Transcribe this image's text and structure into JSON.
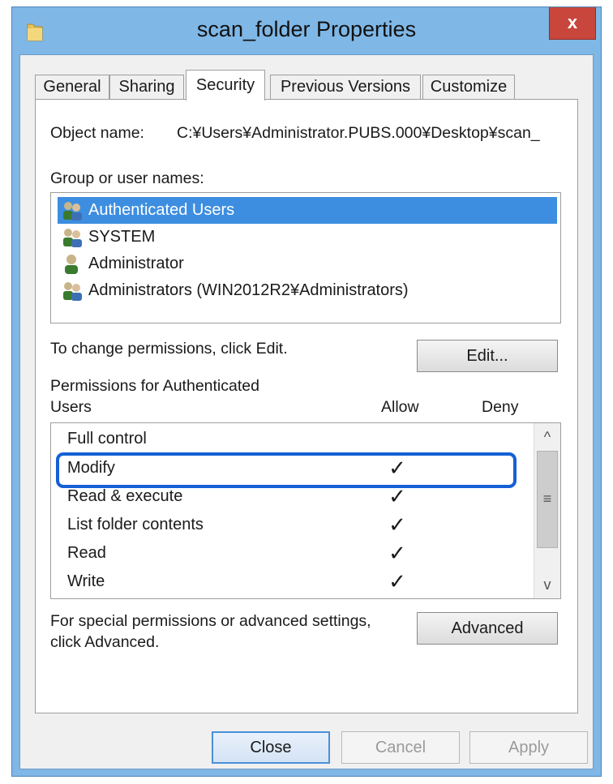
{
  "window": {
    "title": "scan_folder Properties",
    "close_label": "x"
  },
  "tabs": [
    {
      "label": "General",
      "active": false
    },
    {
      "label": "Sharing",
      "active": false
    },
    {
      "label": "Security",
      "active": true
    },
    {
      "label": "Previous Versions",
      "active": false
    },
    {
      "label": "Customize",
      "active": false
    }
  ],
  "security": {
    "object_name_label": "Object name:",
    "object_name_value": "C:¥Users¥Administrator.PUBS.000¥Desktop¥scan_",
    "group_label": "Group or user names:",
    "users": [
      {
        "label": "Authenticated Users",
        "icon": "group-users-icon",
        "selected": true
      },
      {
        "label": "SYSTEM",
        "icon": "group-users-icon",
        "selected": false
      },
      {
        "label": "Administrator",
        "icon": "single-user-icon",
        "selected": false
      },
      {
        "label": "Administrators (WIN2012R2¥Administrators)",
        "icon": "group-users-icon",
        "selected": false
      }
    ],
    "change_text": "To change permissions, click Edit.",
    "edit_button": "Edit...",
    "permissions_label_line1": "Permissions for Authenticated",
    "permissions_label_line2": "Users",
    "allow_header": "Allow",
    "deny_header": "Deny",
    "permissions": [
      {
        "name": "Full control",
        "allow": false,
        "deny": false
      },
      {
        "name": "Modify",
        "allow": true,
        "deny": false
      },
      {
        "name": "Read & execute",
        "allow": true,
        "deny": false
      },
      {
        "name": "List folder contents",
        "allow": true,
        "deny": false
      },
      {
        "name": "Read",
        "allow": true,
        "deny": false
      },
      {
        "name": "Write",
        "allow": true,
        "deny": false
      }
    ],
    "check_mark": "✓",
    "advanced_text_line1": "For special permissions or advanced settings,",
    "advanced_text_line2": "click Advanced.",
    "advanced_button": "Advanced"
  },
  "footer": {
    "close_button": "Close",
    "cancel_button": "Cancel",
    "apply_button": "Apply"
  },
  "scroll": {
    "up_arrow": "^",
    "down_arrow": "v",
    "thumb_grip": "≡"
  },
  "colors": {
    "title_bar": "#7fb7e6",
    "close_button": "#c9463d",
    "selection": "#3d8ee0",
    "highlight_outline": "#1560d6"
  }
}
